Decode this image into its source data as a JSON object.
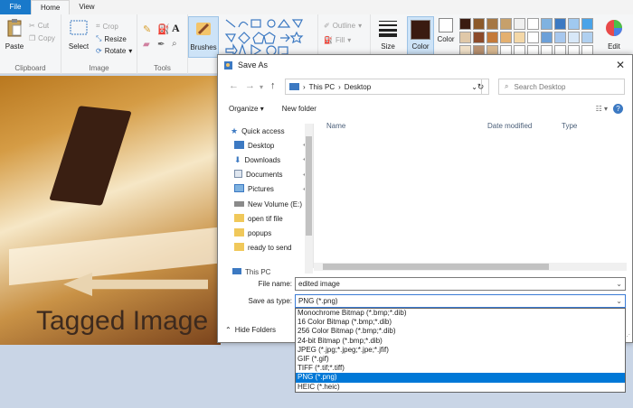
{
  "menubar": {
    "file": "File",
    "tabs": [
      "Home",
      "View"
    ]
  },
  "ribbon": {
    "clipboard": {
      "paste": "Paste",
      "cut": "Cut",
      "copy": "Copy",
      "label": "Clipboard"
    },
    "image": {
      "select": "Select",
      "crop": "Crop",
      "resize": "Resize",
      "rotate": "Rotate",
      "label": "Image"
    },
    "tools": {
      "label": "Tools"
    },
    "brushes": "Brushes",
    "shapes": {
      "outline": "Outline",
      "fill": "Fill"
    },
    "size": "Size",
    "color1": "Color",
    "color2": "Color",
    "edit": "Edit",
    "palette": [
      "#3a1b10",
      "#8b5a2b",
      "#a57744",
      "#c6a06b",
      "#f0f0f0",
      "#ffffff",
      "#7fb2e0",
      "#3c79c2",
      "#a0c9f0",
      "#4aa3e8",
      "#e0c8a8",
      "#8b4a2a",
      "#c47a3a",
      "#e4b070",
      "#f4d8a8",
      "#ffffff",
      "#6ca0d8",
      "#a8c8ee",
      "#d8e8f8",
      "#b0d0f0",
      "#f0e0c8",
      "#b89070",
      "#d8b890",
      "#ffffff",
      "#ffffff",
      "#ffffff",
      "#ffffff",
      "#ffffff",
      "#ffffff",
      "#ffffff"
    ],
    "primary_color": "#3a1b10",
    "secondary_color": "#ffffff"
  },
  "canvas": {
    "overlay_text": "Tagged Image"
  },
  "dialog": {
    "title": "Save As",
    "address": {
      "segments": [
        "This PC",
        "Desktop"
      ]
    },
    "search_placeholder": "Search Desktop",
    "organize": "Organize",
    "new_folder": "New folder",
    "nav_items": [
      {
        "label": "Quick access",
        "icon": "star-icon",
        "pinned": false
      },
      {
        "label": "Desktop",
        "icon": "desktop-icon",
        "pinned": true
      },
      {
        "label": "Downloads",
        "icon": "download-icon",
        "pinned": true
      },
      {
        "label": "Documents",
        "icon": "documents-icon",
        "pinned": true
      },
      {
        "label": "Pictures",
        "icon": "pictures-icon",
        "pinned": true
      },
      {
        "label": "New Volume (E:)",
        "icon": "drive-icon",
        "pinned": false
      },
      {
        "label": "open tif file",
        "icon": "folder-icon",
        "pinned": false
      },
      {
        "label": "popups",
        "icon": "folder-icon",
        "pinned": false
      },
      {
        "label": "ready to send",
        "icon": "folder-icon",
        "pinned": false
      }
    ],
    "this_pc": "This PC",
    "columns": [
      "Name",
      "Date modified",
      "Type"
    ],
    "file_name_label": "File name:",
    "file_name_value": "edited image",
    "save_as_type_label": "Save as type:",
    "save_as_type_value": "PNG (*.png)",
    "hide_folders": "Hide Folders",
    "type_options": [
      "Monochrome Bitmap (*.bmp;*.dib)",
      "16 Color Bitmap (*.bmp;*.dib)",
      "256 Color Bitmap (*.bmp;*.dib)",
      "24-bit Bitmap (*.bmp;*.dib)",
      "JPEG (*.jpg;*.jpeg;*.jpe;*.jfif)",
      "GIF (*.gif)",
      "TIFF (*.tif;*.tiff)",
      "PNG (*.png)",
      "HEIC (*.heic)"
    ],
    "selected_type_index": 7
  }
}
